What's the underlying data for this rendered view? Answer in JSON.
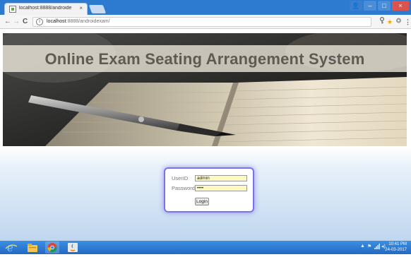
{
  "browser": {
    "tab_title": "localhost:8888/androide",
    "tab_close": "×",
    "window_controls": {
      "user": "👤",
      "minimize": "–",
      "maximize": "□",
      "close": "×"
    },
    "url_host": "localhost",
    "url_path": ":8888/androidexam/",
    "nav": {
      "back": "←",
      "forward": "→",
      "reload": "C"
    }
  },
  "page": {
    "banner_title": "Online Exam Seating Arrangement System",
    "login": {
      "userid_label": "UserID",
      "userid_value": "admin",
      "password_label": "Password",
      "password_value": "••••",
      "login_button": "Login"
    }
  },
  "taskbar": {
    "clock_time": "10:41 PM",
    "clock_date": "24-03-2017",
    "apps": [
      "internet-explorer-icon",
      "file-explorer-icon",
      "chrome-icon",
      "java-icon"
    ]
  },
  "colors": {
    "titlebar": "#2c7bd1",
    "taskbar": "#2369c4",
    "login_border": "#7c72f0",
    "field_bg": "#fdf9c0"
  }
}
